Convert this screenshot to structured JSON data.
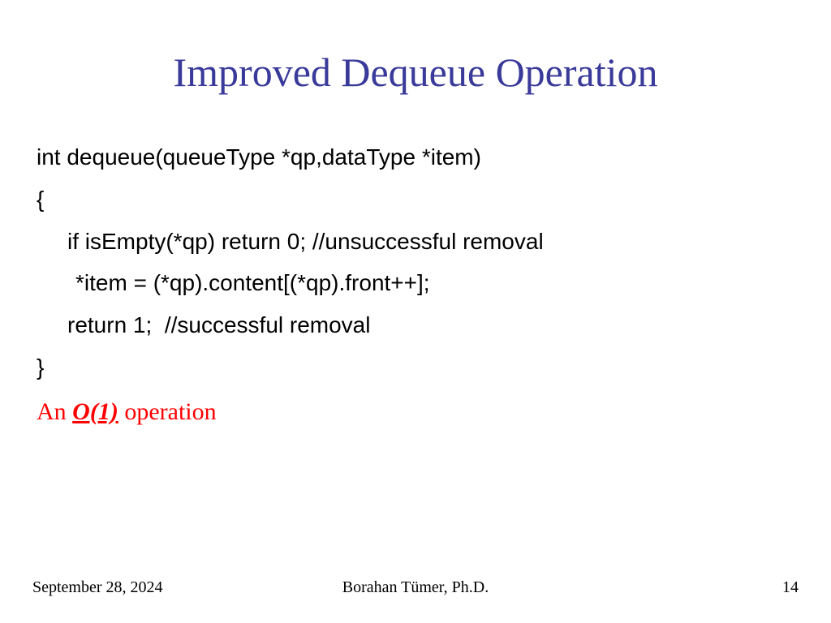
{
  "title": "Improved Dequeue Operation",
  "code": {
    "line1": "int dequeue(queueType *qp,dataType *item)",
    "line2": "{",
    "line3": "if isEmpty(*qp) return 0; //unsuccessful removal",
    "line4": "*item = (*qp).content[(*qp).front++];",
    "line5": "return 1;  //successful removal",
    "line6": "}"
  },
  "note": {
    "prefix": "An ",
    "bigO": "O(1)",
    "suffix": " operation"
  },
  "footer": {
    "date": "September 28, 2024",
    "author": "Borahan Tümer, Ph.D.",
    "page": "14"
  }
}
